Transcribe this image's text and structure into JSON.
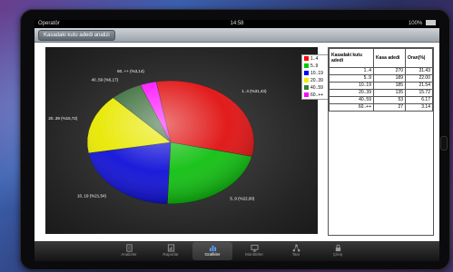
{
  "status": {
    "carrier": "Operatör",
    "time": "14:58",
    "battery": "100%"
  },
  "nav": {
    "back_label": "Kasadaki kutu adedi analizi"
  },
  "legend": [
    {
      "label": "1..4",
      "color": "#ff0000"
    },
    {
      "label": "5..9",
      "color": "#00cc00"
    },
    {
      "label": "10..19",
      "color": "#0000ff"
    },
    {
      "label": "20..39",
      "color": "#eeee00"
    },
    {
      "label": "40..59",
      "color": "#3b7a3b"
    },
    {
      "label": "60..++",
      "color": "#ff00ff"
    }
  ],
  "chart_data": {
    "type": "pie",
    "labels": [
      "1..4 (%31,43)",
      "5..9 (%22,00)",
      "10..19 (%21,54)",
      "20..39 (%15,72)",
      "40..59 (%6,17)",
      "60..++ (%3,14)"
    ],
    "categories": [
      "1..4",
      "5..9",
      "10..19",
      "20..39",
      "40..59",
      "60..++"
    ],
    "values": [
      31.43,
      22.0,
      21.54,
      15.72,
      6.17,
      3.14
    ],
    "colors": [
      "#e01010",
      "#10c010",
      "#1010d8",
      "#e8e800",
      "#3b6e3b",
      "#ff10ff"
    ]
  },
  "table": {
    "headers": [
      "Kasadaki kutu adedi",
      "Kasa adedi",
      "Oran(%)"
    ],
    "rows": [
      [
        "1..4",
        "270",
        "31.43"
      ],
      [
        "5..9",
        "189",
        "22.00"
      ],
      [
        "10..19",
        "185",
        "21.54"
      ],
      [
        "20..39",
        "135",
        "15.72"
      ],
      [
        "40..59",
        "53",
        "6.17"
      ],
      [
        "60..++",
        "27",
        "3.14"
      ]
    ]
  },
  "tabs": [
    {
      "label": "Analizler",
      "icon": "document-icon"
    },
    {
      "label": "Raporlar",
      "icon": "report-icon"
    },
    {
      "label": "Grafikler",
      "icon": "chart-icon"
    },
    {
      "label": "Monitörler",
      "icon": "monitor-icon"
    },
    {
      "label": "Tanı",
      "icon": "network-icon"
    },
    {
      "label": "Çıkış",
      "icon": "lock-icon"
    }
  ],
  "selected_tab": "Grafikler"
}
